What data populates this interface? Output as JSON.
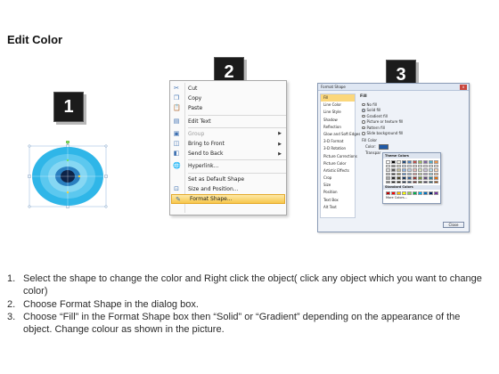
{
  "title": "Edit Color",
  "badges": [
    "1",
    "2",
    "3"
  ],
  "context_menu": {
    "items": [
      {
        "label": "Cut",
        "icon": "scissors-icon",
        "disabled": false,
        "submenu": false,
        "selected": false,
        "sep_after": false
      },
      {
        "label": "Copy",
        "icon": "copy-icon",
        "disabled": false,
        "submenu": false,
        "selected": false,
        "sep_after": false
      },
      {
        "label": "Paste",
        "icon": "paste-icon",
        "disabled": false,
        "submenu": false,
        "selected": false,
        "sep_after": true
      },
      {
        "label": "Edit Text",
        "icon": "text-box-icon",
        "disabled": false,
        "submenu": false,
        "selected": false,
        "sep_after": true
      },
      {
        "label": "Group",
        "icon": "group-icon",
        "disabled": true,
        "submenu": true,
        "selected": false,
        "sep_after": false
      },
      {
        "label": "Bring to Front",
        "icon": "bring-front-icon",
        "disabled": false,
        "submenu": true,
        "selected": false,
        "sep_after": false
      },
      {
        "label": "Send to Back",
        "icon": "send-back-icon",
        "disabled": false,
        "submenu": true,
        "selected": false,
        "sep_after": true
      },
      {
        "label": "Hyperlink...",
        "icon": "hyperlink-icon",
        "disabled": false,
        "submenu": false,
        "selected": false,
        "sep_after": true
      },
      {
        "label": "Set as Default Shape",
        "icon": "",
        "disabled": false,
        "submenu": false,
        "selected": false,
        "sep_after": false
      },
      {
        "label": "Size and Position...",
        "icon": "size-position-icon",
        "disabled": false,
        "submenu": false,
        "selected": false,
        "sep_after": false
      },
      {
        "label": "Format Shape...",
        "icon": "format-shape-icon",
        "disabled": false,
        "submenu": false,
        "selected": true,
        "sep_after": false
      }
    ]
  },
  "dialog": {
    "title": "Format Shape",
    "close_glyph": "x",
    "categories": [
      "Fill",
      "Line Color",
      "Line Style",
      "Shadow",
      "Reflection",
      "Glow and Soft Edges",
      "3-D Format",
      "3-D Rotation",
      "Picture Corrections",
      "Picture Color",
      "Artistic Effects",
      "Crop",
      "Size",
      "Position",
      "Text Box",
      "Alt Text"
    ],
    "selected_category": "Fill",
    "heading": "Fill",
    "fill_options": [
      {
        "label": "No fill",
        "on": false
      },
      {
        "label": "Solid fill",
        "on": true
      },
      {
        "label": "Gradient fill",
        "on": false
      },
      {
        "label": "Picture or texture fill",
        "on": false
      },
      {
        "label": "Pattern fill",
        "on": false
      },
      {
        "label": "Slide background fill",
        "on": false
      }
    ],
    "fill_color_label": "Fill Color",
    "color_label": "Color:",
    "transparency_label": "Transpar",
    "close_button": "Close",
    "palette": {
      "theme_heading": "Theme Colors",
      "standard_heading": "Standard Colors",
      "more_colors": "More Colors...",
      "theme_top": [
        "#ffffff",
        "#000000",
        "#eeece1",
        "#1f497d",
        "#4f81bd",
        "#c0504d",
        "#9bbb59",
        "#8064a2",
        "#4bacc6",
        "#f79646"
      ],
      "theme_rows": [
        [
          "#f2f2f2",
          "#7f7f7f",
          "#ddd9c3",
          "#c6d9f0",
          "#dbe5f1",
          "#f2dcdb",
          "#ebf1dd",
          "#e5e0ec",
          "#dbeef3",
          "#fdeada"
        ],
        [
          "#d8d8d8",
          "#595959",
          "#c4bd97",
          "#8db3e2",
          "#b8cce4",
          "#e5b9b7",
          "#d7e3bc",
          "#ccc1d9",
          "#b7dde8",
          "#fbd5b5"
        ],
        [
          "#bfbfbf",
          "#3f3f3f",
          "#938953",
          "#548dd4",
          "#95b3d7",
          "#d99694",
          "#c3d69b",
          "#b2a2c7",
          "#92cddc",
          "#fac08f"
        ],
        [
          "#a5a5a5",
          "#262626",
          "#494429",
          "#17365d",
          "#366092",
          "#953734",
          "#76923c",
          "#5f497a",
          "#31859b",
          "#e36c09"
        ],
        [
          "#7f7f7f",
          "#0c0c0c",
          "#1d1b10",
          "#0f243e",
          "#244061",
          "#632423",
          "#4f6128",
          "#3f3151",
          "#205867",
          "#974806"
        ]
      ],
      "standard": [
        "#c00000",
        "#ff0000",
        "#ffc000",
        "#ffff00",
        "#92d050",
        "#00b050",
        "#00b0f0",
        "#0070c0",
        "#002060",
        "#7030a0"
      ]
    }
  },
  "steps": [
    {
      "num": "1.",
      "text": "Select the shape to change the color and Right click the object( click any object which you want to change color)"
    },
    {
      "num": "2.",
      "text": "Choose Format Shape in the dialog box."
    },
    {
      "num": "3.",
      "text": "Choose “Fill” in the Format Shape box then “Solid” or “Gradient” depending on the appearance of the object. Change colour as shown in the picture."
    }
  ],
  "colors": {
    "target_outer": "#2fb6e8",
    "target_mid": "#6fd0f0",
    "target_inner": "#1b4f86",
    "target_center": "#0d2348",
    "menu_highlight": "#f7c64a",
    "dialog_selected": "#fbd77b"
  }
}
